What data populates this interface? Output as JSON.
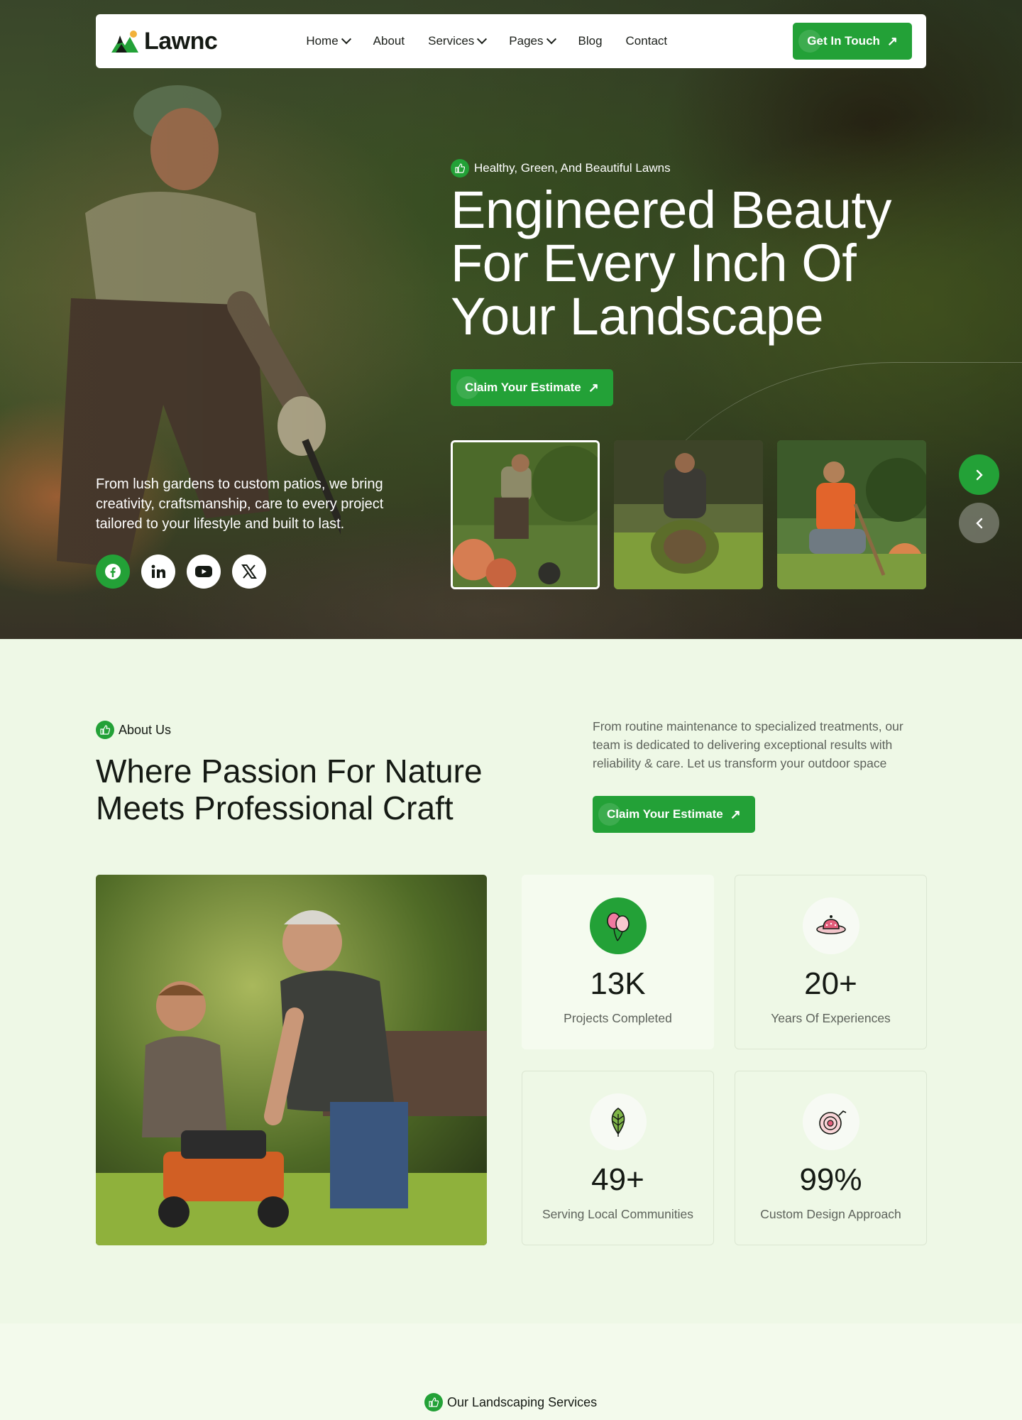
{
  "brand": {
    "name": "Lawnc",
    "accent": "#23a137",
    "background": "#eef8e6"
  },
  "nav": {
    "items": [
      {
        "label": "Home",
        "has_dropdown": true
      },
      {
        "label": "About",
        "has_dropdown": false
      },
      {
        "label": "Services",
        "has_dropdown": true
      },
      {
        "label": "Pages",
        "has_dropdown": true
      },
      {
        "label": "Blog",
        "has_dropdown": false
      },
      {
        "label": "Contact",
        "has_dropdown": false
      }
    ],
    "cta_label": "Get In Touch"
  },
  "hero": {
    "tagline": "Healthy, Green, And Beautiful Lawns",
    "title": "Engineered Beauty For Every Inch Of Your Landscape",
    "cta_label": "Claim Your Estimate",
    "description": "From lush gardens to custom patios, we bring creativity, craftsmanship, care to every project tailored to your lifestyle and built to last.",
    "socials": [
      "facebook-icon",
      "linkedin-icon",
      "youtube-icon",
      "x-icon"
    ],
    "thumbnails": [
      "gardener-mowing",
      "laying-turf-roll",
      "gardener-with-shovel"
    ],
    "selected_thumbnail": 1
  },
  "about": {
    "tag": "About Us",
    "title": "Where Passion For Nature Meets Professional Craft",
    "description": "From routine maintenance to specialized treatments, our team is dedicated to delivering exceptional results with reliability & care. Let us transform your outdoor space",
    "cta_label": "Claim Your Estimate",
    "stats": [
      {
        "value": "13K",
        "label": "Projects Completed",
        "icon": "balloons-icon"
      },
      {
        "value": "20+",
        "label": "Years Of Experiences",
        "icon": "hat-icon"
      },
      {
        "value": "49+",
        "label": "Serving Local Communities",
        "icon": "leaf-icon"
      },
      {
        "value": "99%",
        "label": "Custom Design Approach",
        "icon": "hose-reel-icon"
      }
    ]
  },
  "services": {
    "tag": "Our Landscaping Services"
  }
}
